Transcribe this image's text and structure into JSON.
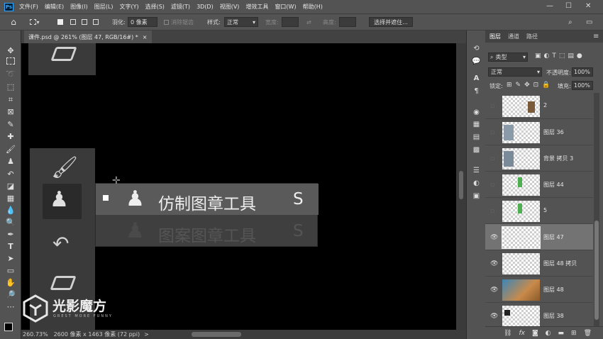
{
  "app": {
    "logo": "Ps"
  },
  "menu": [
    "文件(F)",
    "编辑(E)",
    "图像(I)",
    "图层(L)",
    "文字(Y)",
    "选择(S)",
    "滤镜(T)",
    "3D(D)",
    "视图(V)",
    "增效工具",
    "窗口(W)",
    "帮助(H)"
  ],
  "window_controls": [
    "—",
    "☐",
    "✕"
  ],
  "options": {
    "feather_label": "羽化:",
    "feather_value": "0 像素",
    "antialias_label": "消除锯齿",
    "style_label": "样式:",
    "style_value": "正常",
    "width_label": "宽度:",
    "height_label": "高度:",
    "select_mask_button": "选择并遮住..."
  },
  "document": {
    "tab_title": "课件.psd @ 261% (图层 47, RGB/16#) *",
    "close": "×"
  },
  "canvas": {
    "popup": {
      "items": [
        {
          "label": "仿制图章工具",
          "shortcut": "S",
          "selected": true
        },
        {
          "label": "图案图章工具",
          "shortcut": "S",
          "selected": false
        }
      ]
    },
    "watermark": {
      "brand": "光影魔方",
      "slogan": "GREST MORE FUNNY"
    }
  },
  "status": {
    "zoom": "260.73%",
    "doc_info": "2600 像素 x 1463 像素 (72 ppi)",
    "arrow": ">"
  },
  "layers_panel": {
    "tabs": [
      "图层",
      "通道",
      "路径"
    ],
    "filter_label": "类型",
    "blend_mode": "正常",
    "opacity_label": "不透明度:",
    "opacity_value": "100%",
    "lock_label": "锁定:",
    "fill_label": "填充:",
    "fill_value": "100%",
    "layers": [
      {
        "name": "2",
        "visible": false,
        "selected": false
      },
      {
        "name": "图层 36",
        "visible": false,
        "selected": false
      },
      {
        "name": "背景 拷贝 3",
        "visible": false,
        "selected": false
      },
      {
        "name": "图层 44",
        "visible": false,
        "selected": false
      },
      {
        "name": "5",
        "visible": false,
        "selected": false
      },
      {
        "name": "图层 47",
        "visible": true,
        "selected": true
      },
      {
        "name": "图层 48 拷贝",
        "visible": true,
        "selected": false
      },
      {
        "name": "图层 48",
        "visible": true,
        "selected": false
      },
      {
        "name": "图层 38",
        "visible": true,
        "selected": false
      }
    ],
    "footer_icons": [
      "link-icon",
      "fx-icon",
      "mask-icon",
      "adjustment-icon",
      "folder-icon",
      "new-layer-icon",
      "trash-icon"
    ],
    "footer_fx": "fx"
  },
  "colors": {
    "ui_bg": "#535353",
    "selected_layer": "#737373",
    "canvas": "#000000",
    "accent": "#31a8ff"
  }
}
